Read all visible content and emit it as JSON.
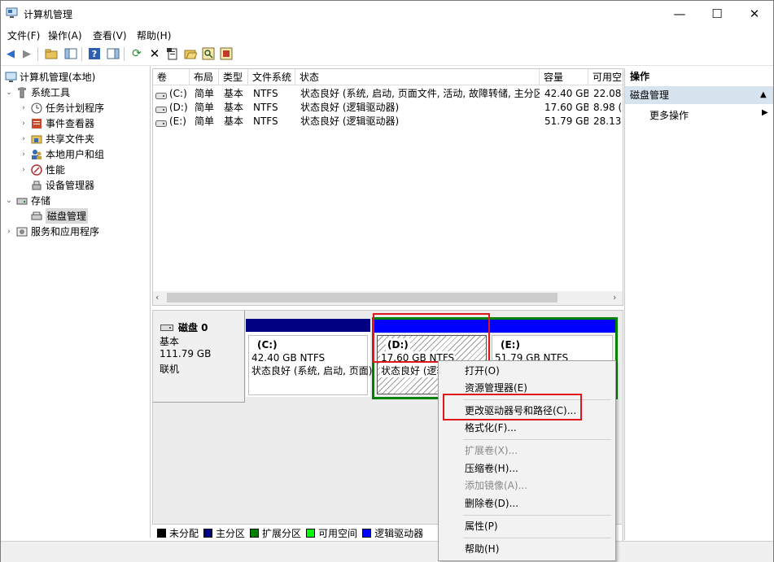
{
  "window": {
    "title": "计算机管理",
    "minimize": "—",
    "maximize": "☐",
    "close": "✕"
  },
  "menu": [
    "文件(F)",
    "操作(A)",
    "查看(V)",
    "帮助(H)"
  ],
  "tree": {
    "root": "计算机管理(本地)",
    "system_tools": "系统工具",
    "task_scheduler": "任务计划程序",
    "event_viewer": "事件查看器",
    "shared_folders": "共享文件夹",
    "local_users": "本地用户和组",
    "performance": "性能",
    "device_manager": "设备管理器",
    "storage": "存储",
    "disk_management": "磁盘管理",
    "services": "服务和应用程序"
  },
  "volume_table": {
    "headers": [
      "卷",
      "布局",
      "类型",
      "文件系统",
      "状态",
      "容量",
      "可用空"
    ],
    "rows": [
      [
        "(C:)",
        "简单",
        "基本",
        "NTFS",
        "状态良好 (系统, 启动, 页面文件, 活动, 故障转储, 主分区)",
        "42.40 GB",
        "22.08"
      ],
      [
        "(D:)",
        "简单",
        "基本",
        "NTFS",
        "状态良好 (逻辑驱动器)",
        "17.60 GB",
        "8.98 ("
      ],
      [
        "(E:)",
        "简单",
        "基本",
        "NTFS",
        "状态良好 (逻辑驱动器)",
        "51.79 GB",
        "28.13"
      ]
    ]
  },
  "disk": {
    "name": "磁盘 0",
    "type": "基本",
    "size": "111.79 GB",
    "status": "联机",
    "partitions": [
      {
        "letter": "(C:)",
        "size": "42.40 GB NTFS",
        "status": "状态良好 (系统, 启动, 页面)"
      },
      {
        "letter": "(D:)",
        "size": "17.60 GB NTFS",
        "status": "状态良好 (逻辑"
      },
      {
        "letter": "(E:)",
        "size": "51.79 GB NTFS",
        "status": ""
      }
    ]
  },
  "legend": [
    "未分配",
    "主分区",
    "扩展分区",
    "可用空间",
    "逻辑驱动器"
  ],
  "colors": {
    "unallocated": "#000000",
    "primary": "#000080",
    "extended": "#008000",
    "free": "#00ff00",
    "logical": "#0000ff",
    "highlight": "#e0171a"
  },
  "actions": {
    "header": "操作",
    "section": "磁盘管理",
    "more": "更多操作"
  },
  "context_menu": {
    "open": "打开(O)",
    "explorer": "资源管理器(E)",
    "change_letter": "更改驱动器号和路径(C)...",
    "format": "格式化(F)...",
    "extend": "扩展卷(X)...",
    "shrink": "压缩卷(H)...",
    "mirror": "添加镜像(A)...",
    "delete": "删除卷(D)...",
    "properties": "属性(P)",
    "help": "帮助(H)"
  }
}
